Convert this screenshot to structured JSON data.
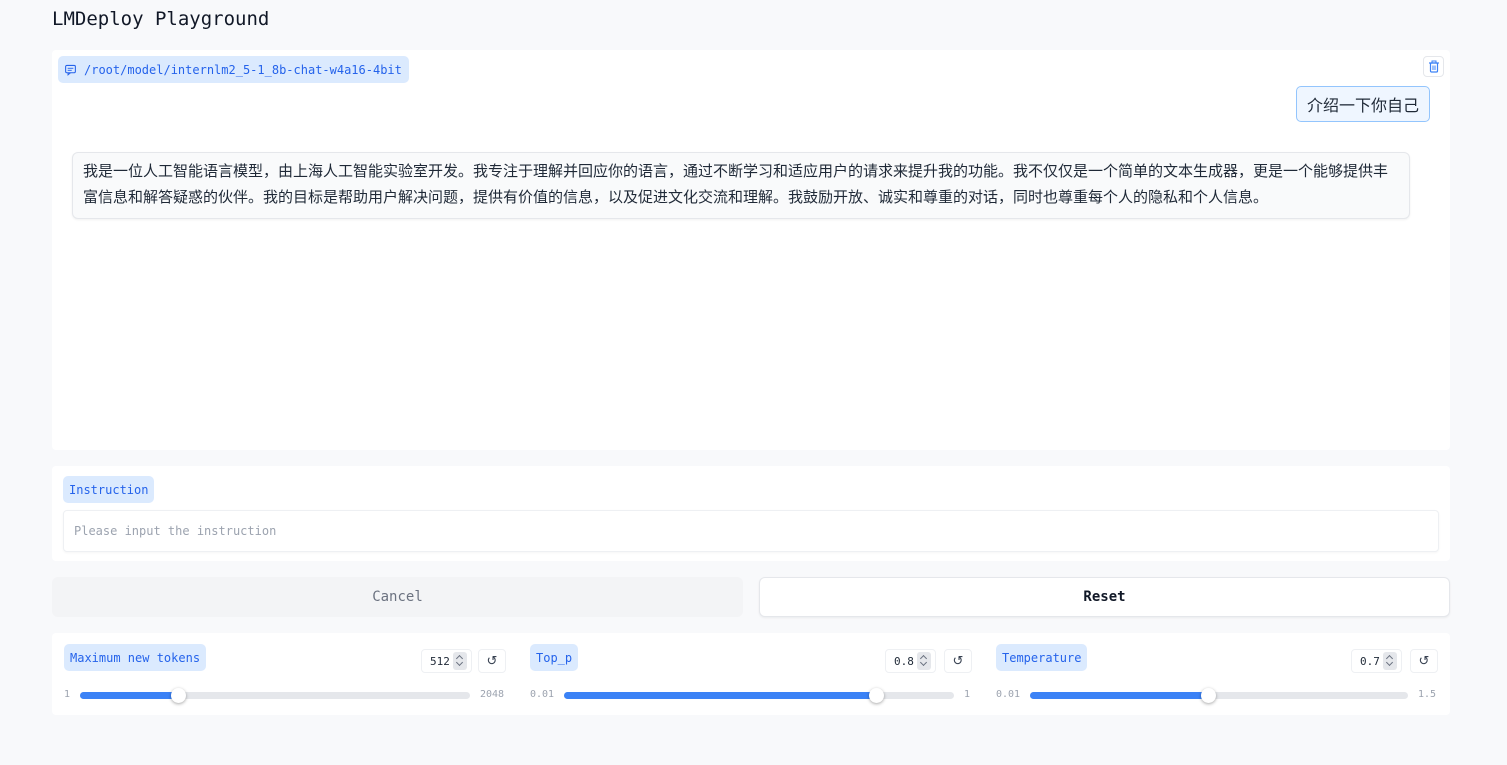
{
  "app": {
    "title": "LMDeploy Playground"
  },
  "chat": {
    "model_path": "/root/model/internlm2_5-1_8b-chat-w4a16-4bit",
    "user_message": "介绍一下你自己",
    "bot_message": "我是一位人工智能语言模型，由上海人工智能实验室开发。我专注于理解并回应你的语言，通过不断学习和适应用户的请求来提升我的功能。我不仅仅是一个简单的文本生成器，更是一个能够提供丰富信息和解答疑惑的伙伴。我的目标是帮助用户解决问题，提供有价值的信息，以及促进文化交流和理解。我鼓励开放、诚实和尊重的对话，同时也尊重每个人的隐私和个人信息。"
  },
  "instruction": {
    "label": "Instruction",
    "placeholder": "Please input the instruction",
    "value": ""
  },
  "buttons": {
    "cancel_label": "Cancel",
    "reset_label": "Reset"
  },
  "params": {
    "max_tokens": {
      "label": "Maximum new tokens",
      "value": "512",
      "min": "1",
      "max": "2048",
      "fraction": 0.25
    },
    "top_p": {
      "label": "Top_p",
      "value": "0.8",
      "min": "0.01",
      "max": "1",
      "fraction": 0.8
    },
    "temperature": {
      "label": "Temperature",
      "value": "0.7",
      "min": "0.01",
      "max": "1.5",
      "fraction": 0.47
    },
    "reset_glyph": "↺"
  },
  "colors": {
    "accent": "#3b82f6",
    "chip_bg": "#dbeafe",
    "chip_text": "#2563eb"
  }
}
